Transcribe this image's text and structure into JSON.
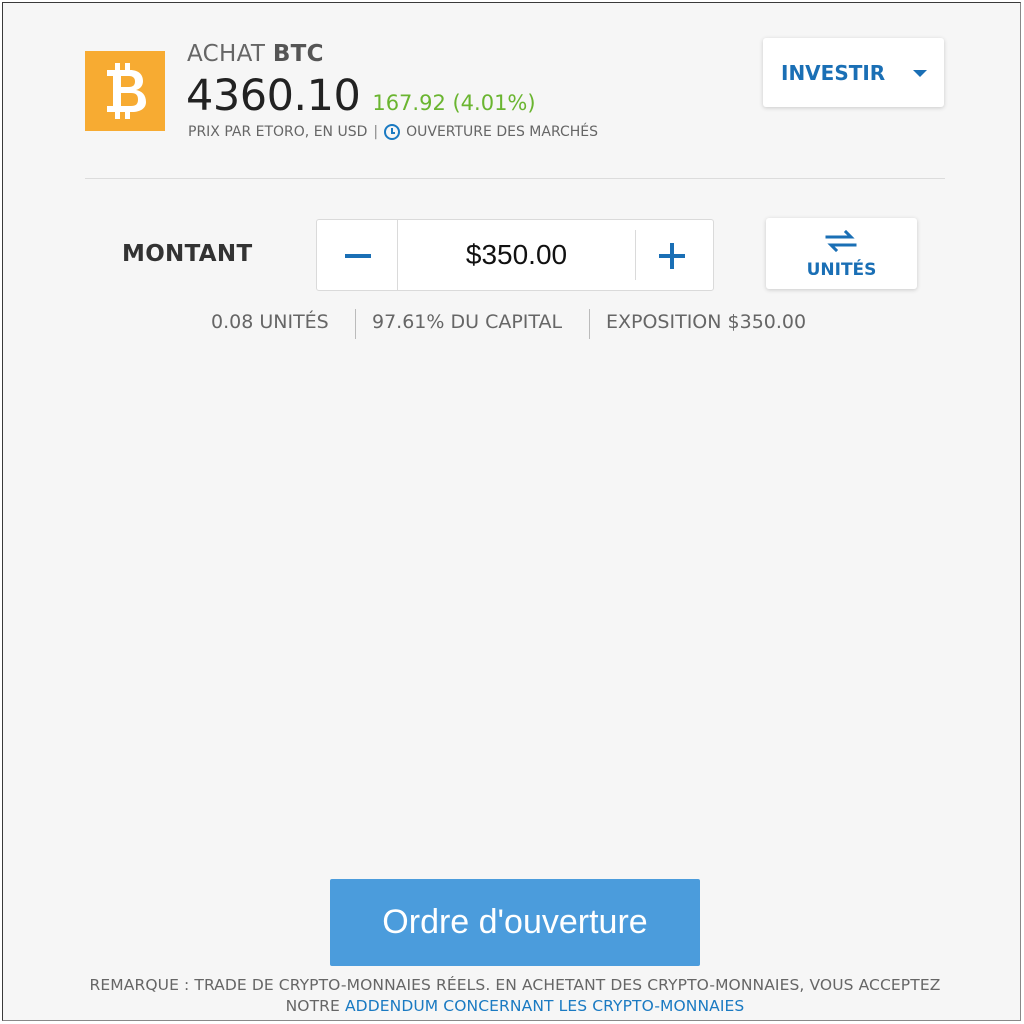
{
  "header": {
    "logo_icon": "bitcoin-icon",
    "action": "ACHAT",
    "symbol": "BTC",
    "price": "4360.10",
    "change": "167.92 (4.01%)",
    "price_source": "PRIX PAR ETORO, EN USD",
    "separator": "|",
    "market_status": "OUVERTURE DES MARCHÉS",
    "colors": {
      "logo": "#f7ab32",
      "positive": "#6ab530",
      "accent": "#1a6fb5"
    }
  },
  "mode_selector": {
    "label": "INVESTIR",
    "icon": "caret-down-icon"
  },
  "amount": {
    "label": "MONTANT",
    "value": "$350.00",
    "minus_icon": "minus-icon",
    "plus_icon": "plus-icon"
  },
  "toggle_units": {
    "label": "UNITÉS",
    "icon": "swap-arrows-icon"
  },
  "stats": {
    "units": "0.08 UNITÉS",
    "capital": "97.61% DU CAPITAL",
    "exposure": "EXPOSITION $350.00"
  },
  "submit": {
    "label": "Ordre d'ouverture",
    "color": "#4b9cdc"
  },
  "disclaimer": {
    "line1": "REMARQUE : TRADE DE CRYPTO-MONNAIES RÉELS. EN ACHETANT DES CRYPTO-MONNAIES, VOUS ACCEPTEZ",
    "line2_prefix": "NOTRE",
    "link_text": "ADDENDUM CONCERNANT LES CRYPTO-MONNAIES"
  }
}
